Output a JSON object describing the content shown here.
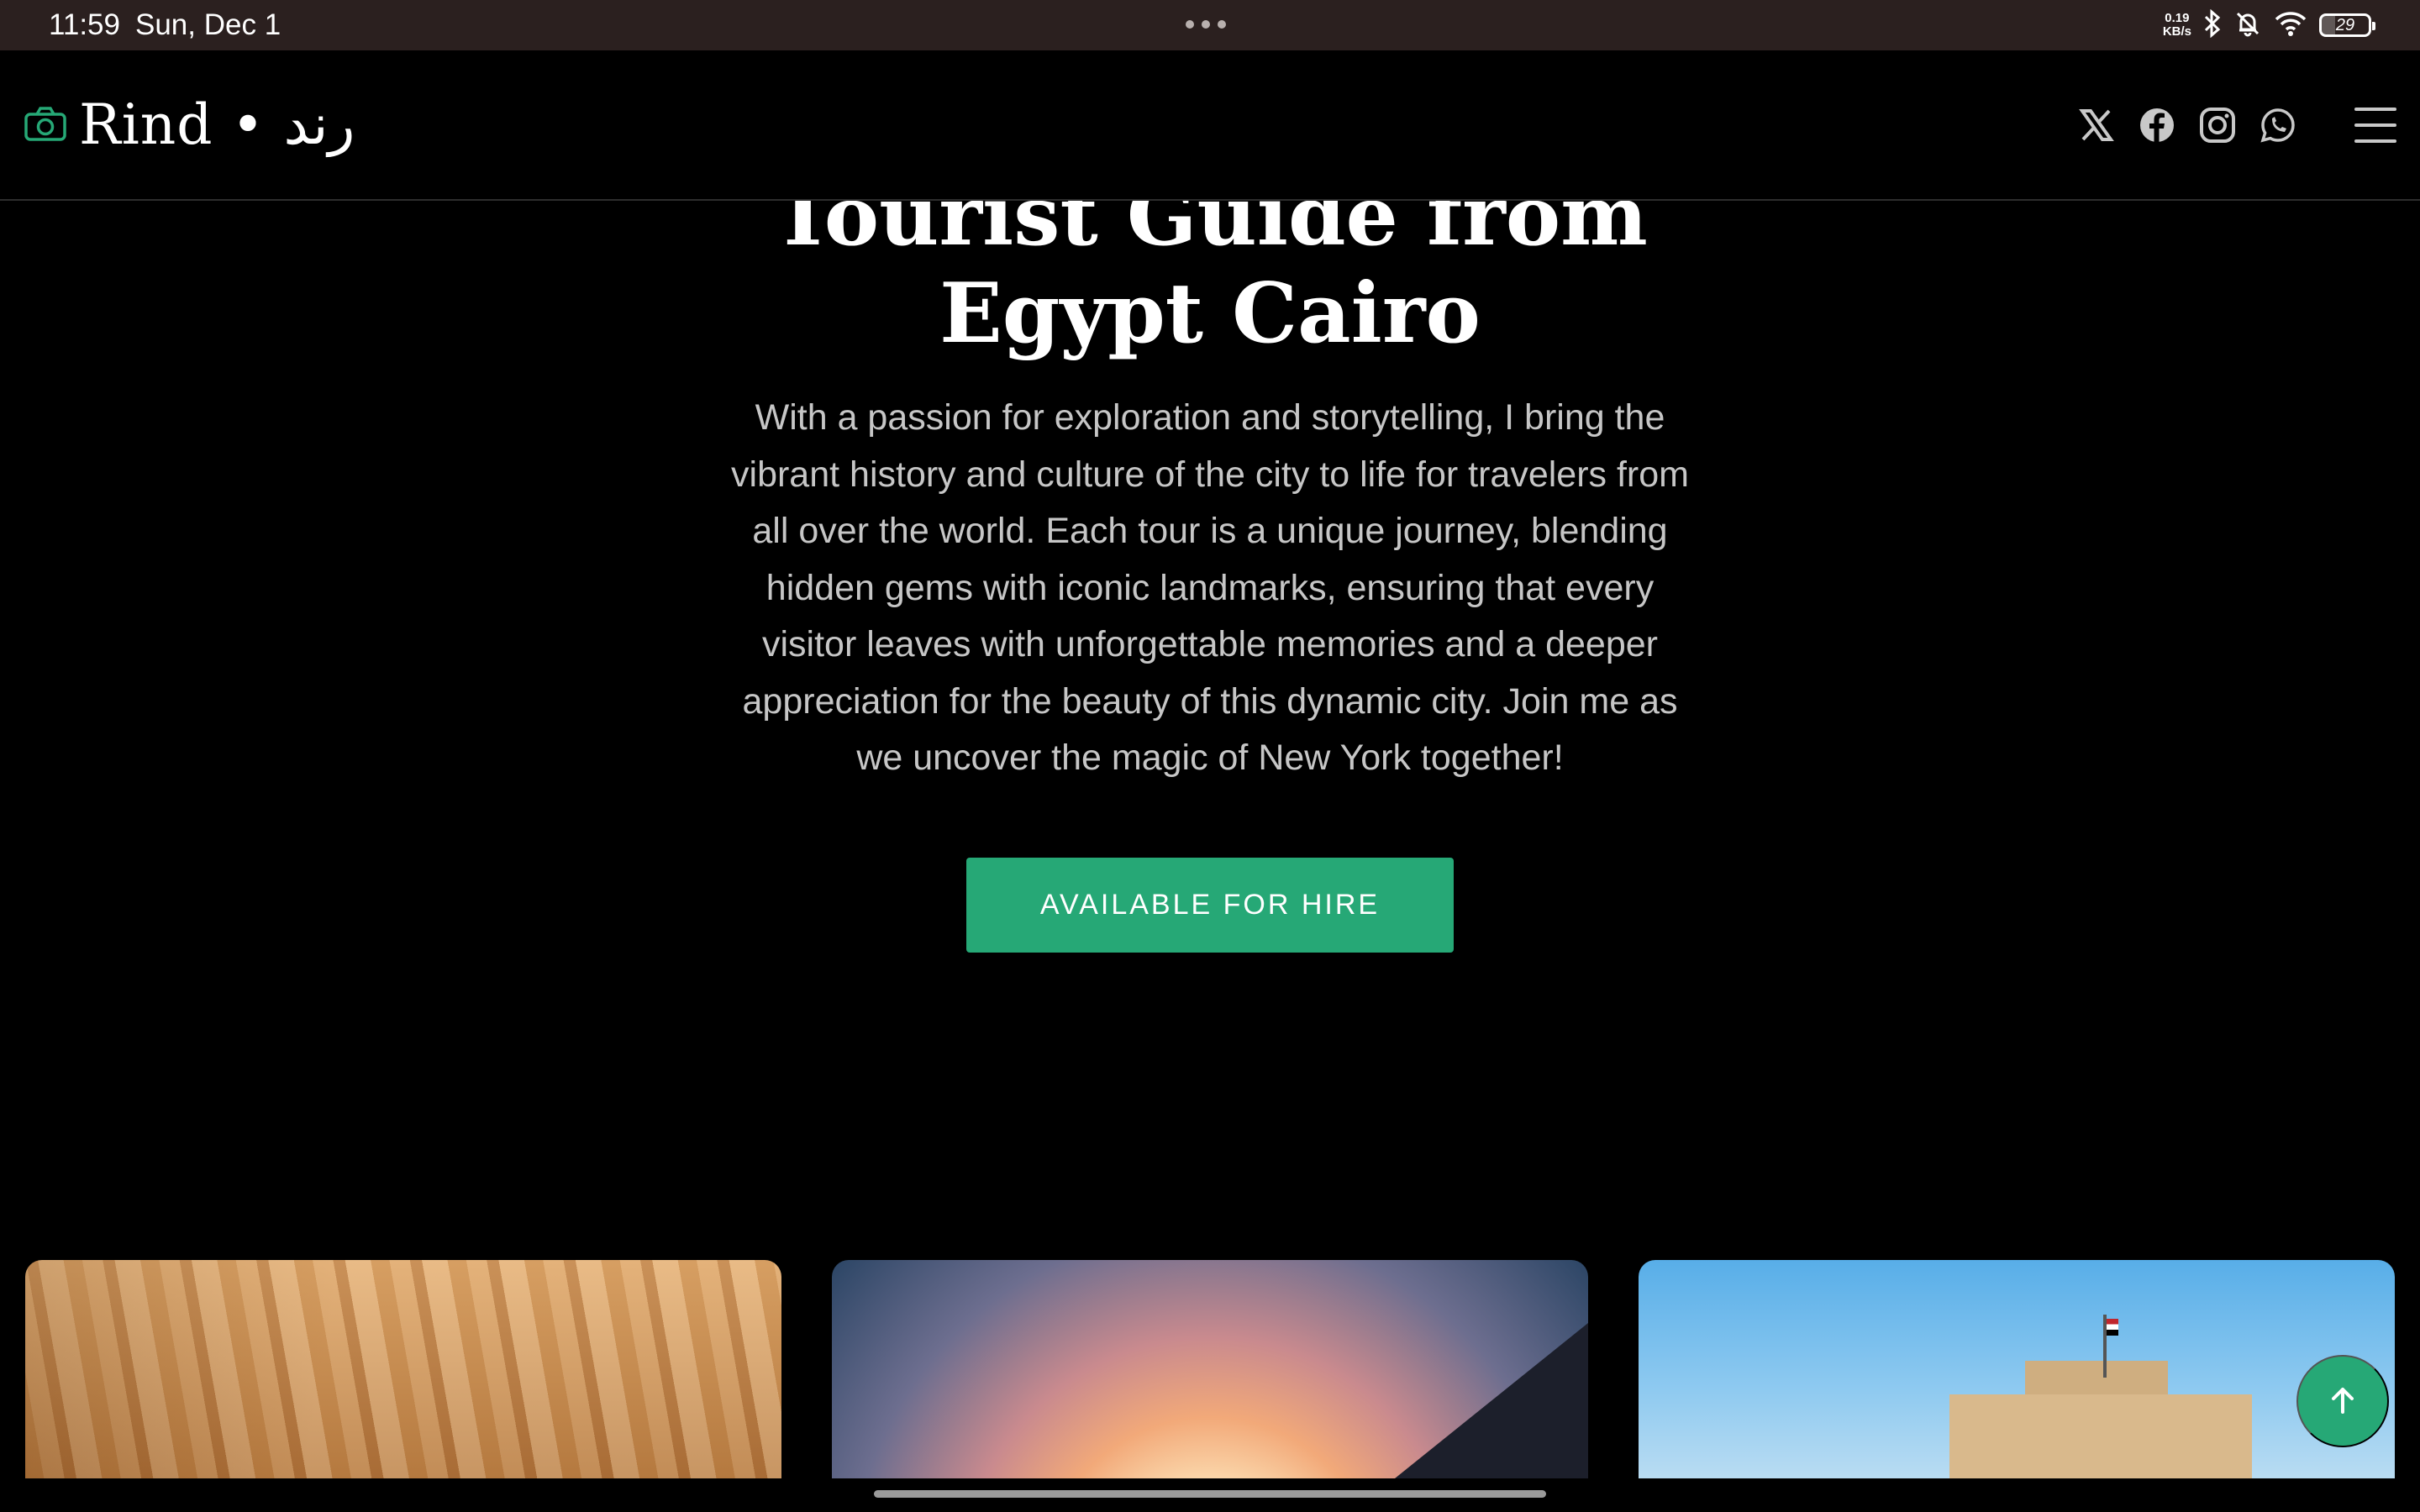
{
  "status_bar": {
    "time": "11:59",
    "date": "Sun, Dec 1",
    "net_speed_value": "0.19",
    "net_speed_unit": "KB/s",
    "battery": "29"
  },
  "header": {
    "brand": "Rind • رند",
    "social": [
      "x-icon",
      "facebook-icon",
      "instagram-icon",
      "whatsapp-icon"
    ],
    "menu_icon": "hamburger-menu-icon"
  },
  "hero": {
    "title": "Tourist Guide from Egypt Cairo",
    "description": "With a passion for exploration and storytelling, I bring the vibrant history and culture of the city to life for travelers from all over the world. Each tour is a unique journey, blending hidden gems with iconic landmarks, ensuring that every visitor leaves with unforgettable memories and a deeper appreciation for the beauty of this dynamic city. Join me as we uncover the magic of New York together!",
    "cta_label": "AVAILABLE FOR HIRE"
  },
  "cards": [
    "desert-cliffs-photo",
    "pyramid-sunset-photo",
    "citadel-photo"
  ],
  "colors": {
    "accent": "#26a876",
    "background": "#000000",
    "status_bar": "#2b201f",
    "body_text": "#c6c6c6"
  }
}
